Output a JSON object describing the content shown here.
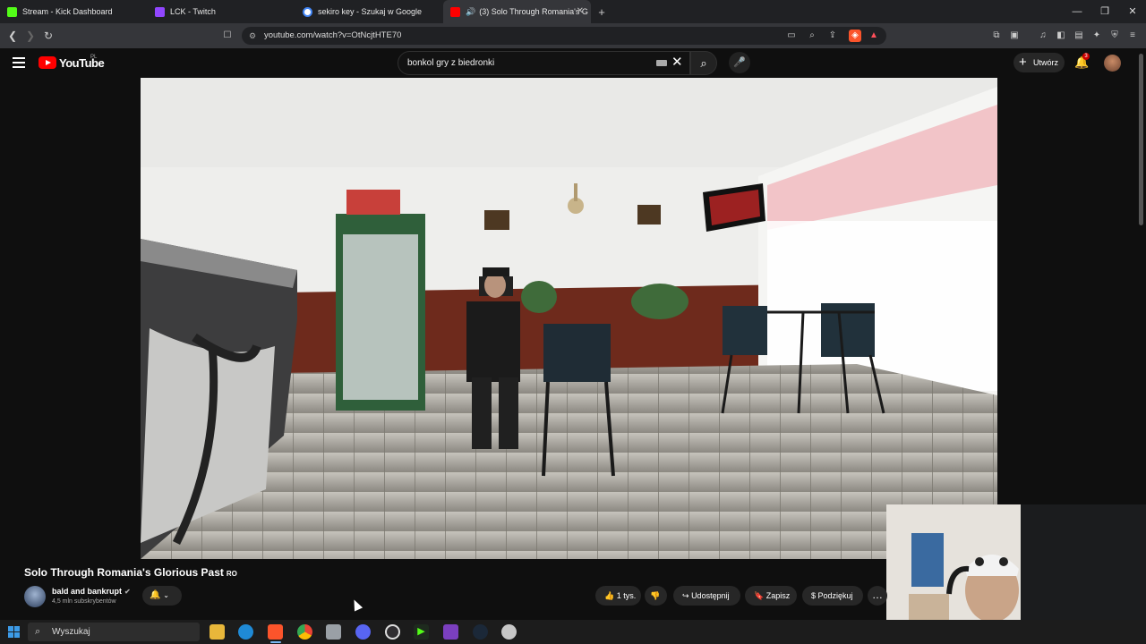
{
  "browser": {
    "tabs": [
      {
        "title": "Stream - Kick Dashboard",
        "favicon_color": "#53fc18"
      },
      {
        "title": "LCK - Twitch",
        "favicon_color": "#9146ff"
      },
      {
        "title": "sekiro key - Szukaj w Google",
        "favicon_color": "#4285f4"
      },
      {
        "title": "(3) Solo Through Romania's G",
        "favicon_color": "#ff0000"
      }
    ],
    "new_tab": "+",
    "url": "youtube.com/watch?v=OtNcjtHTE70"
  },
  "youtube": {
    "logo_text": "YouTube",
    "country_code": "PL",
    "search_query": "bonkol gry z biedronki",
    "create_label": "Utwórz",
    "notification_count": "3"
  },
  "video": {
    "title": "Solo Through Romania's Glorious Past",
    "title_flag": "RO",
    "channel_name": "bald and bankrupt",
    "subscribers": "4,5 mln subskrybentów",
    "likes": "1 tys.",
    "share_label": "Udostępnij",
    "save_label": "Zapisz",
    "thanks_label": "Podziękuj"
  },
  "taskbar": {
    "search_placeholder": "Wyszukaj"
  },
  "colors": {
    "youtube_red": "#ff0000",
    "background": "#0f0f0f",
    "accent_blue": "#3ea6ff"
  }
}
